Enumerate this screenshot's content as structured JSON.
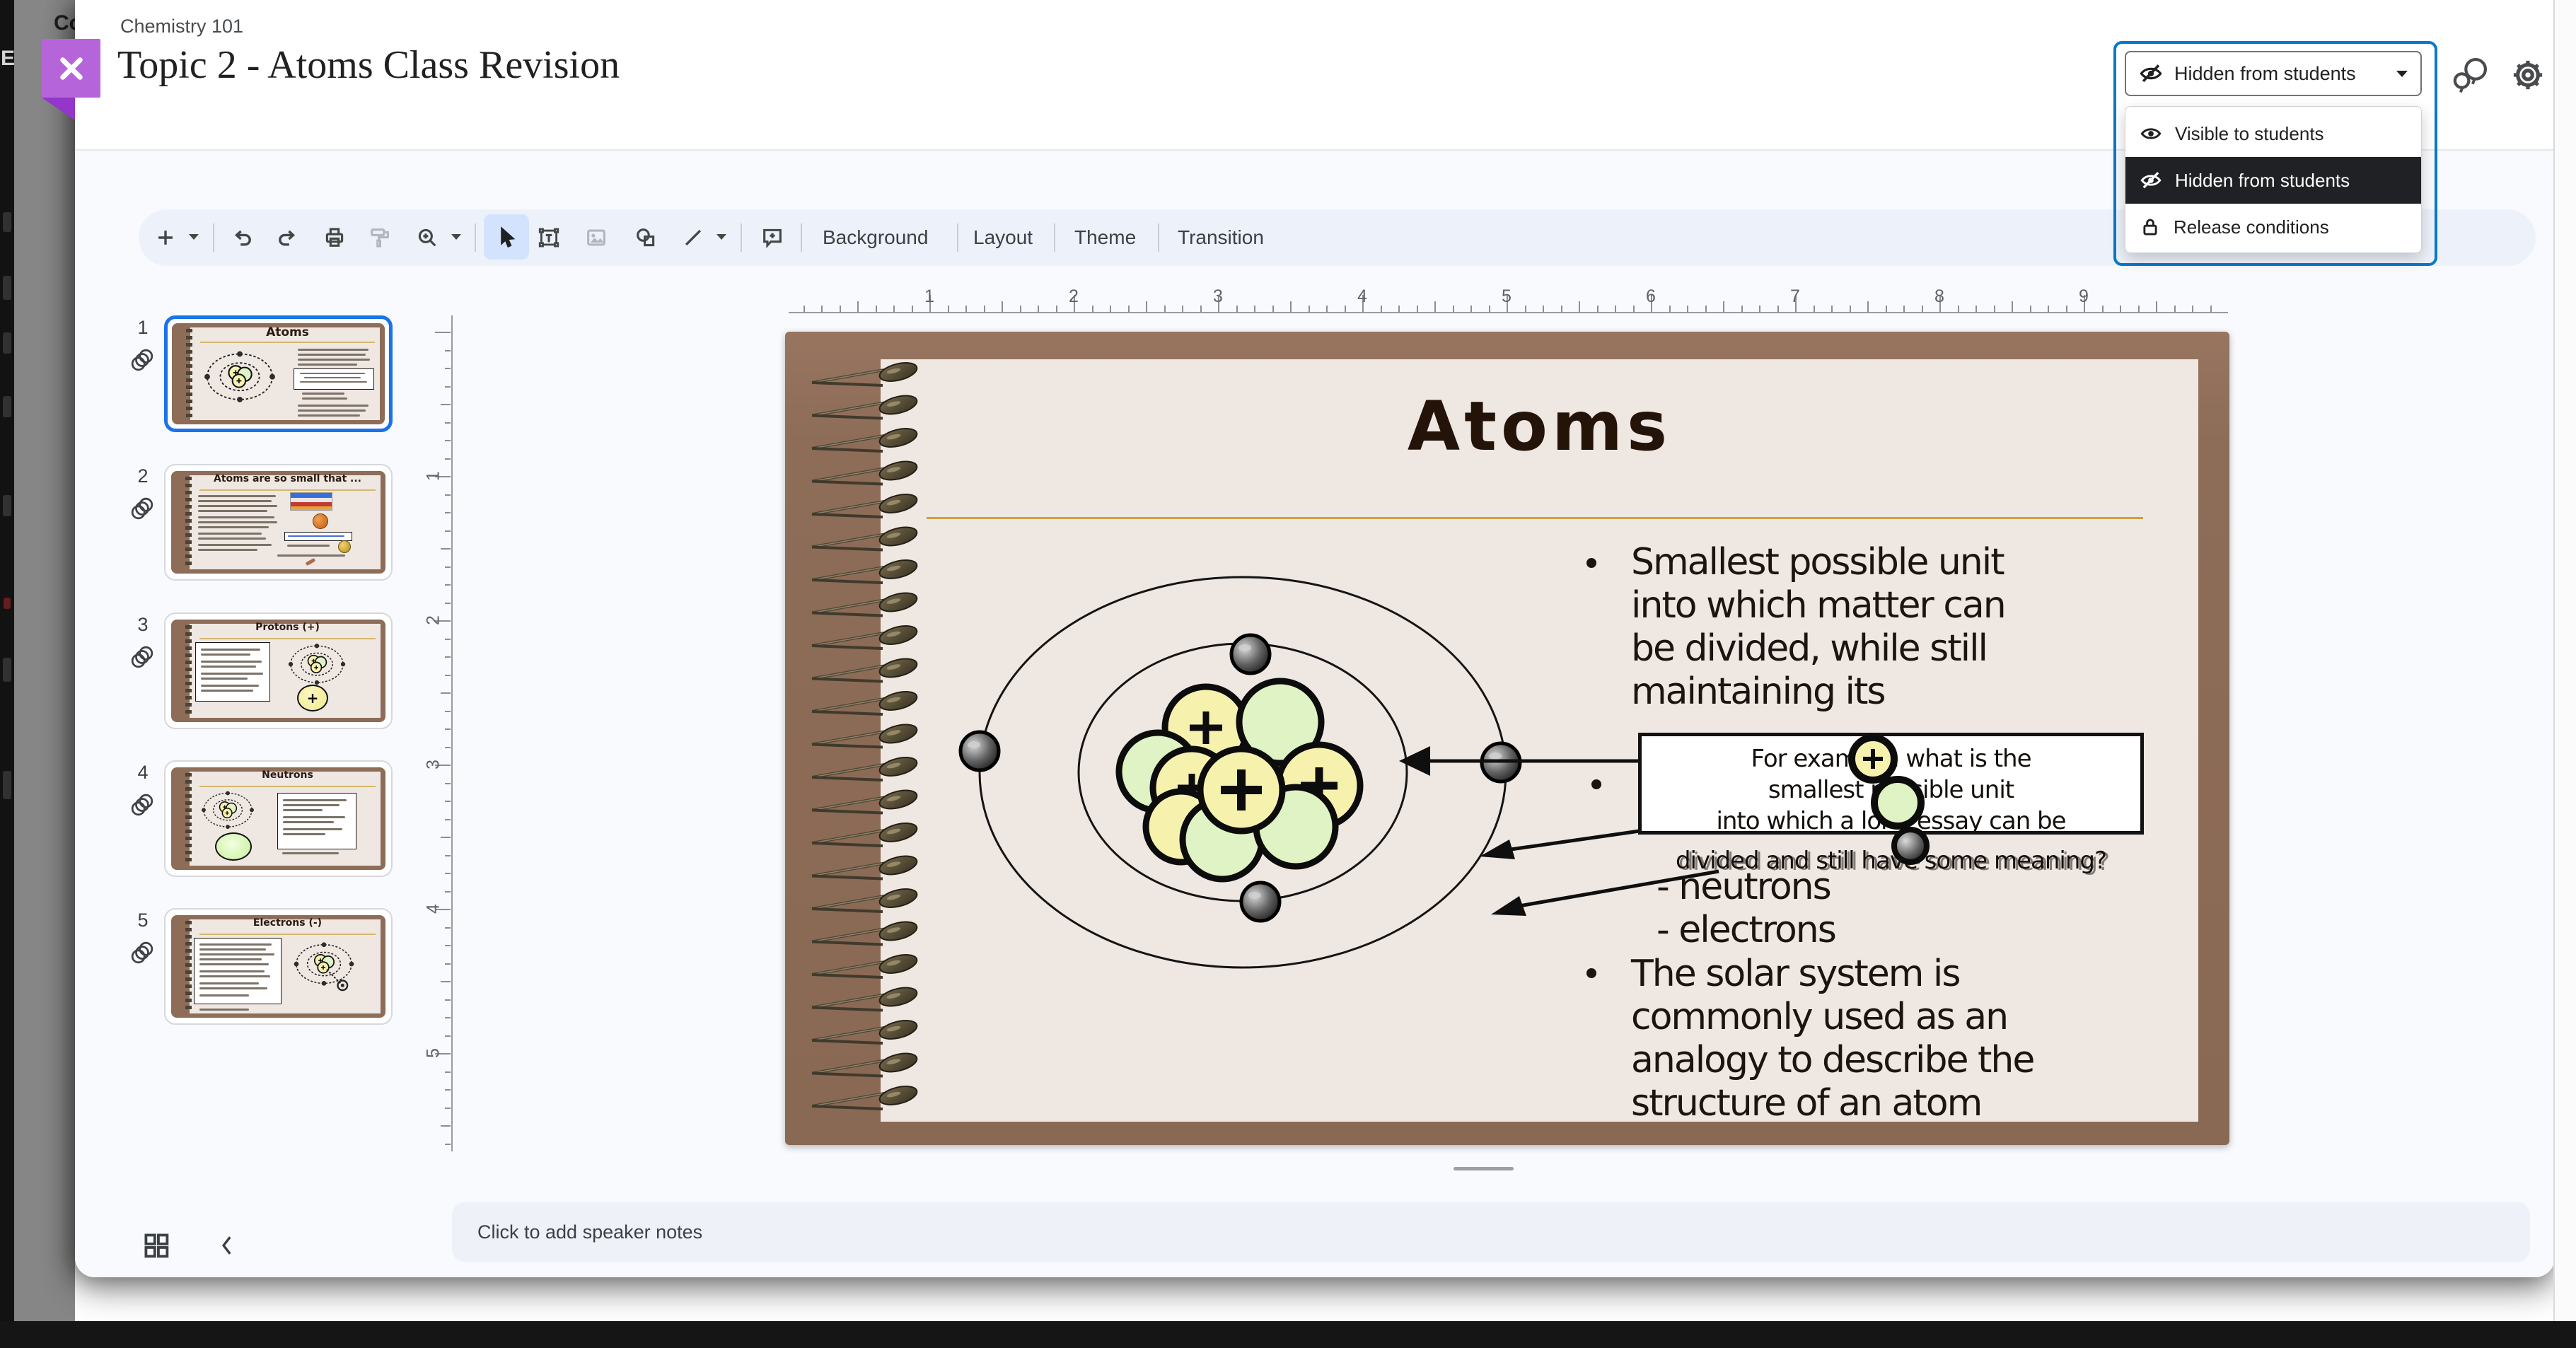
{
  "window": {
    "backdrop_text": "Co",
    "backdrop_letter": "E"
  },
  "header": {
    "breadcrumb": "Chemistry 101",
    "title": "Topic 2 - Atoms Class Revision"
  },
  "visibility": {
    "selected": "Hidden from students",
    "options": [
      {
        "label": "Visible to students",
        "icon": "eye-icon",
        "selected": false
      },
      {
        "label": "Hidden from students",
        "icon": "eye-slash-icon",
        "selected": true
      },
      {
        "label": "Release conditions",
        "icon": "lock-icon",
        "selected": false
      }
    ]
  },
  "toolbar": {
    "buttons": [
      "Background",
      "Layout",
      "Theme",
      "Transition"
    ],
    "selected_tool": "select-cursor"
  },
  "rulers": {
    "horizontal": [
      "1",
      "2",
      "3",
      "4",
      "5",
      "6",
      "7",
      "8",
      "9"
    ],
    "vertical": [
      "1",
      "2",
      "3",
      "4",
      "5"
    ]
  },
  "filmstrip": {
    "slides": [
      {
        "number": "1",
        "title": "Atoms",
        "selected": true
      },
      {
        "number": "2",
        "title": "Atoms are so small that ...",
        "selected": false
      },
      {
        "number": "3",
        "title": "Protons (+)",
        "selected": false
      },
      {
        "number": "4",
        "title": "Neutrons",
        "selected": false
      },
      {
        "number": "5",
        "title": "Electrons (-)",
        "selected": false
      }
    ]
  },
  "slide": {
    "title": "Atoms",
    "bullet1_lines": [
      "Smallest possible unit",
      "into which matter can",
      "be divided, while still",
      "maintaining its"
    ],
    "sub_items": [
      "-  neutrons",
      "-  electrons"
    ],
    "bullet2_lines": [
      "The solar system is",
      "commonly used as an",
      "analogy to describe the",
      "structure of an atom"
    ],
    "callout_lines": [
      "For example, what is the",
      "smallest possible unit",
      "into which a long essay can be"
    ],
    "callout_overflow": "divided and still have some meaning?"
  },
  "notes": {
    "placeholder": "Click to add speaker notes"
  },
  "colors": {
    "accent_blue": "#0a78c9",
    "selection_blue": "#1a73e8",
    "tool_highlight": "#d3e3fd",
    "purple": "#b565d9",
    "purple_dark": "#9336c9",
    "brown": "#8d6c58",
    "paper": "#efe7e2",
    "gold_line": "#c9a23f",
    "menu_selected_bg": "#202124",
    "toolbar_bg": "#edf2fa",
    "canvas_bg": "#f8fafd",
    "notes_bg": "#eef1f8"
  }
}
